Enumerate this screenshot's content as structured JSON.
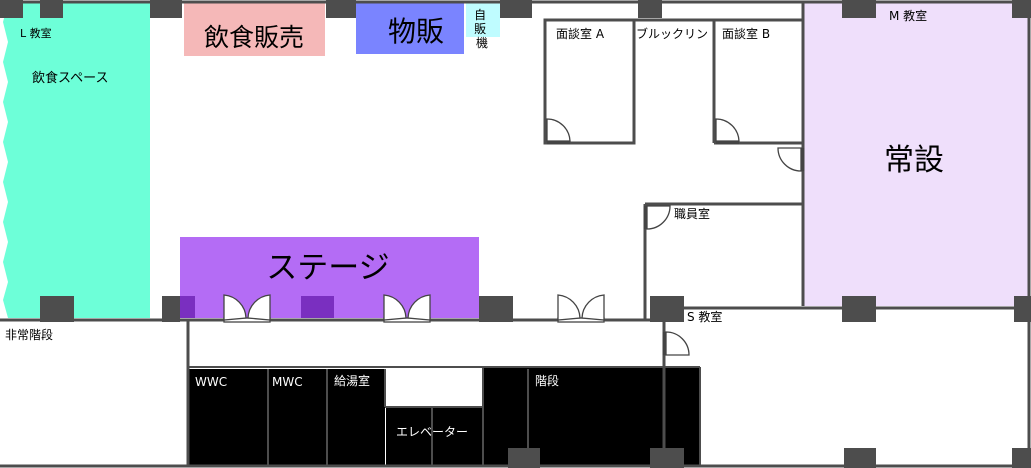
{
  "colors": {
    "eating_space": "#6dffd8",
    "food_sales": "#f5b8b8",
    "goods_sales": "#7a84ff",
    "vending": "#bffcff",
    "stage": "#b46cf5",
    "stage_dark": "#7a2fc0",
    "permanent": "#efdffb",
    "wall": "#4d4d4d",
    "black_room": "#000000"
  },
  "rooms": {
    "l_classroom": "L 教室",
    "eating_space": "飲食スペース",
    "food_sales": "飲食販売",
    "goods_sales": "物販",
    "vending": "自販機",
    "interview_a": "面談室 A",
    "brooklyn": "ブルックリン",
    "interview_b": "面談室 B",
    "m_classroom": "M 教室",
    "permanent": "常設",
    "staff_room": "職員室",
    "stage": "ステージ",
    "emergency_stairs": "非常階段",
    "s_classroom": "S 教室",
    "wwc": "WWC",
    "mwc": "MWC",
    "kitchenette": "給湯室",
    "elevator": "エレベーター",
    "stairs": "階段"
  }
}
